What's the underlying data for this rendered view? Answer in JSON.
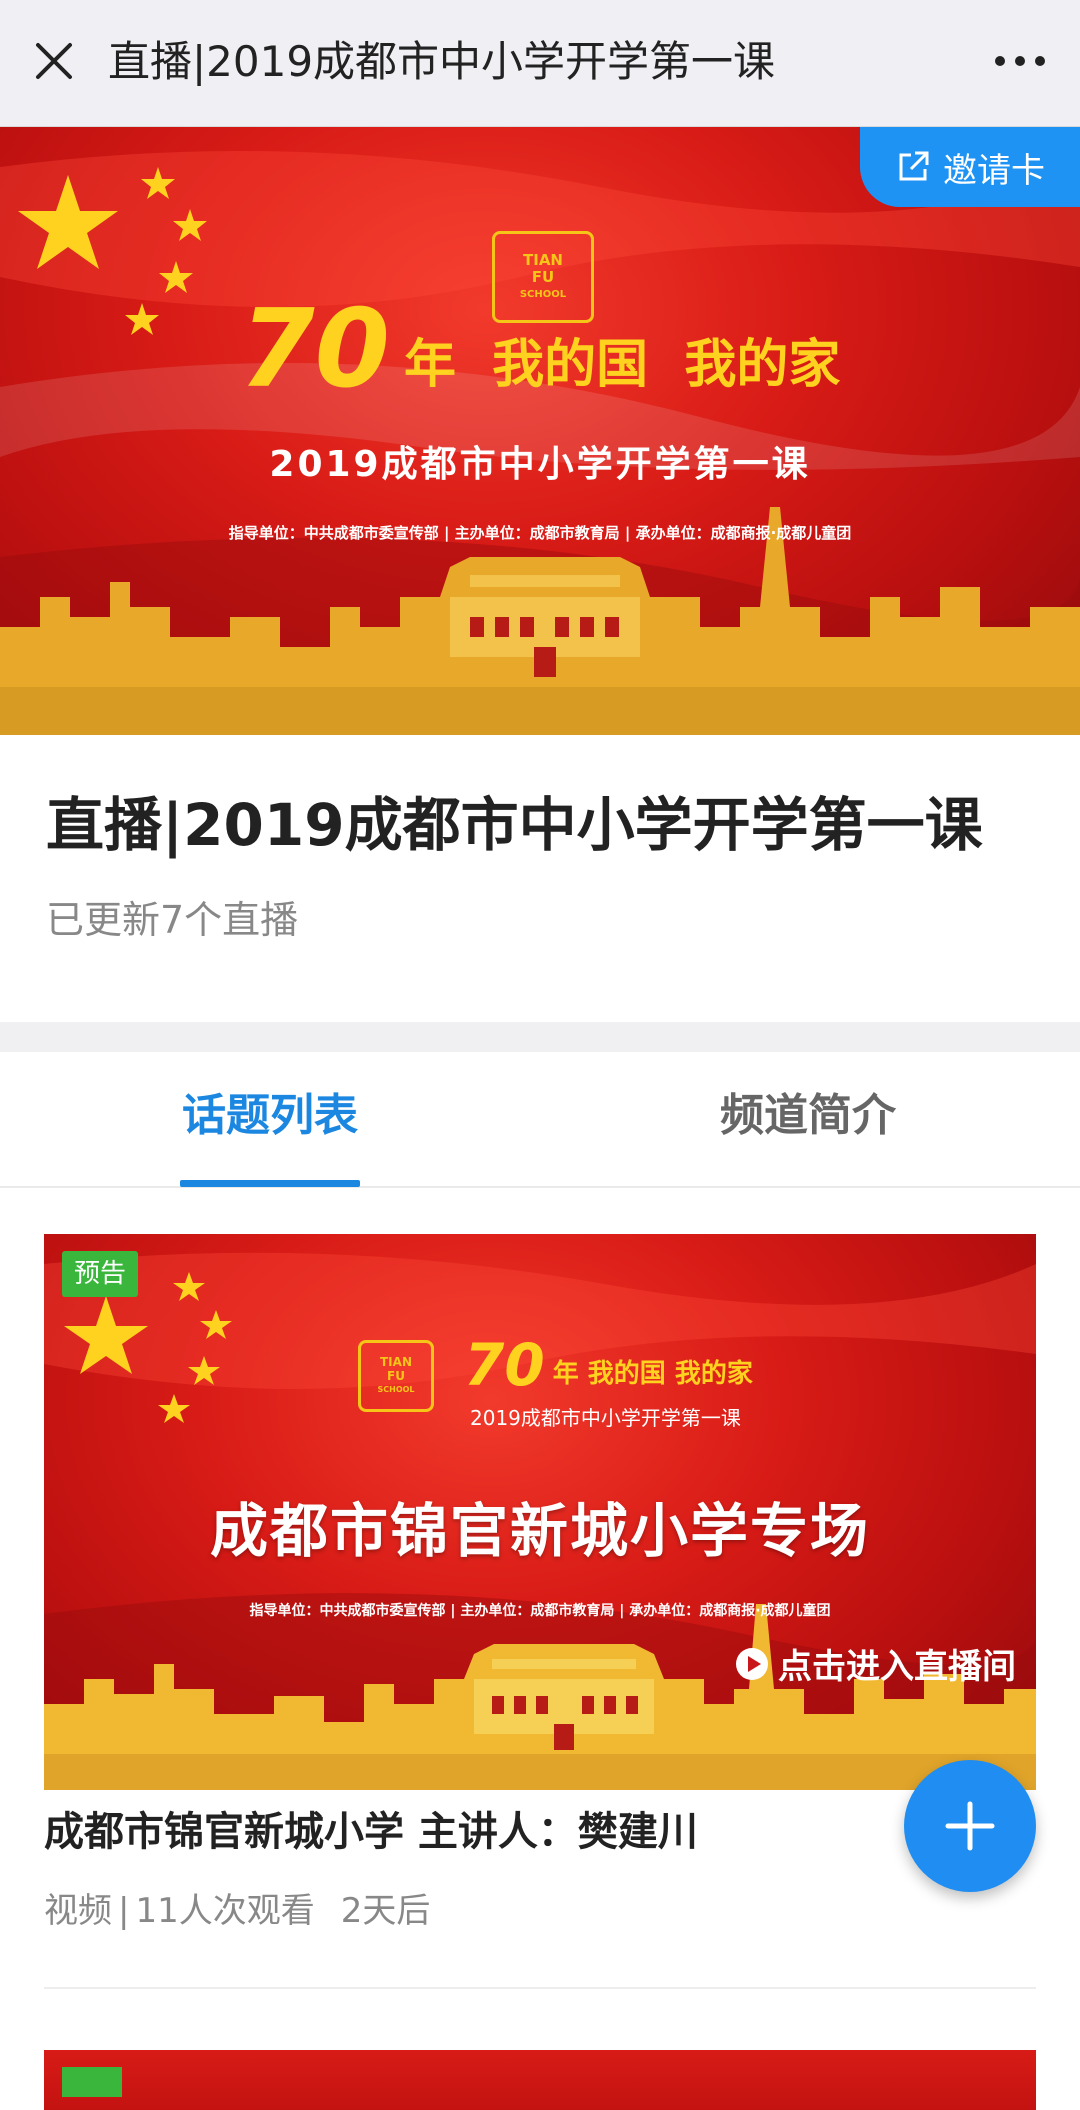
{
  "topbar": {
    "title": "直播|2019成都市中小学开学第一课",
    "close_icon": "close-icon",
    "more_icon": "more-icon"
  },
  "hero": {
    "invite_label": "邀请卡",
    "logo_text": [
      "TIAN",
      "FU",
      "SCHOOL"
    ],
    "seventy": "70",
    "slogan": "年  我的国  我的家",
    "subtitle": "2019成都市中小学开学第一课",
    "credits": "指导单位：中共成都市委宣传部 | 主办单位：成都市教育局 | 承办单位：成都商报·成都儿童团"
  },
  "channel": {
    "title": "直播|2019成都市中小学开学第一课",
    "subtitle": "已更新7个直播"
  },
  "tabs": [
    {
      "label": "话题列表",
      "active": true
    },
    {
      "label": "频道简介",
      "active": false
    }
  ],
  "topics": [
    {
      "tag": "预告",
      "banner_small_title": "年 我的国 我的家",
      "banner_small_seventy": "70",
      "banner_small_subtitle": "2019成都市中小学开学第一课",
      "banner_main": "成都市锦官新城小学专场",
      "banner_credits": "指导单位：中共成都市委宣传部 | 主办单位：成都市教育局 | 承办单位：成都商报·成都儿童团",
      "enter_label": "点击进入直播间",
      "title": "成都市锦官新城小学 主讲人：樊建川",
      "meta_type": "视频",
      "meta_views": "11人次观看",
      "meta_time": "2天后"
    }
  ],
  "colors": {
    "accent": "#1b87e0",
    "flag_red": "#d81b16",
    "gold": "#f5c518",
    "tag_green": "#39b63b",
    "fab_blue": "#1f8df1"
  }
}
